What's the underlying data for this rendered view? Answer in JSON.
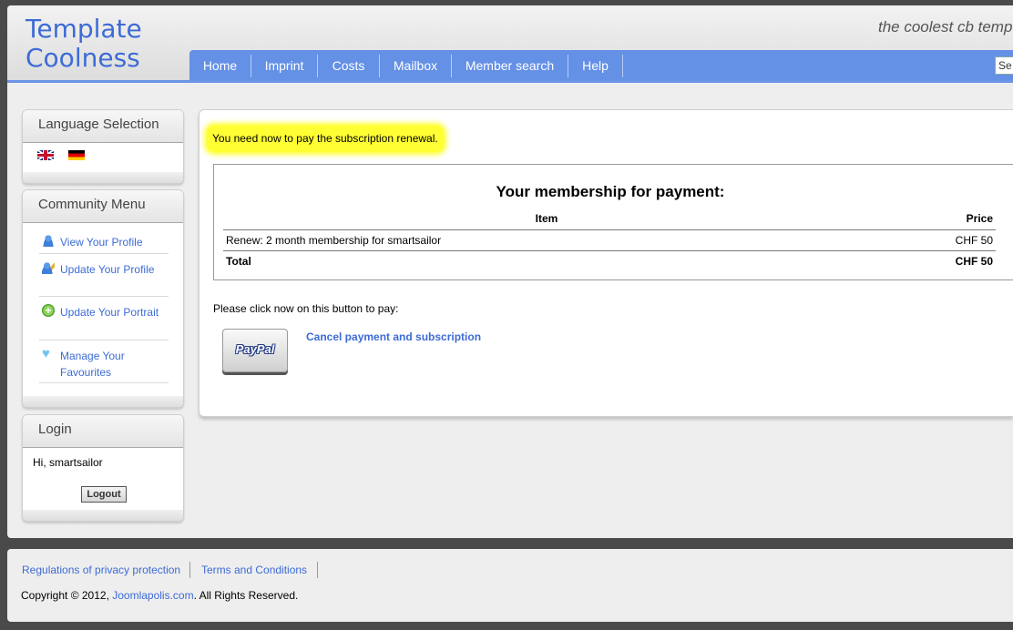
{
  "header": {
    "logo_line1": "Template",
    "logo_line2": "Coolness",
    "tagline": "the coolest cb temp",
    "search_placeholder": "Se"
  },
  "nav": {
    "items": [
      "Home",
      "Imprint",
      "Costs",
      "Mailbox",
      "Member search",
      "Help"
    ]
  },
  "sidebar": {
    "language": {
      "title": "Language Selection",
      "flags": [
        "uk-flag-icon",
        "de-flag-icon"
      ]
    },
    "community": {
      "title": "Community Menu",
      "items": [
        {
          "label": "View Your Profile",
          "icon": "user-icon"
        },
        {
          "label": "Update Your Profile",
          "icon": "user-edit-icon"
        },
        {
          "label": "Update Your Portrait",
          "icon": "add-icon"
        },
        {
          "label": "Manage Your Favourites",
          "icon": "heart-icon"
        }
      ]
    },
    "login": {
      "title": "Login",
      "greeting": "Hi, smartsailor",
      "logout_label": "Logout"
    }
  },
  "main": {
    "notice": "You need now to pay the subscription renewal.",
    "payment": {
      "title": "Your membership for payment:",
      "col_item": "Item",
      "col_price": "Price",
      "row_item": "Renew: 2 month membership for smartsailor",
      "row_price": "CHF 50",
      "total_label": "Total",
      "total_price": "CHF 50"
    },
    "please_click": "Please click now on this button to pay:",
    "paypal_label": "PayPal",
    "cancel_link": "Cancel payment and subscription"
  },
  "footer": {
    "link_privacy": "Regulations of privacy protection",
    "link_terms": "Terms and Conditions",
    "copyright_prefix": "Copyright © 2012, ",
    "copyright_link": "Joomlapolis.com",
    "copyright_suffix": ". All Rights Reserved."
  },
  "colors": {
    "accent": "#6490e6",
    "link": "#3d6bd6",
    "highlight": "#ffff33"
  }
}
